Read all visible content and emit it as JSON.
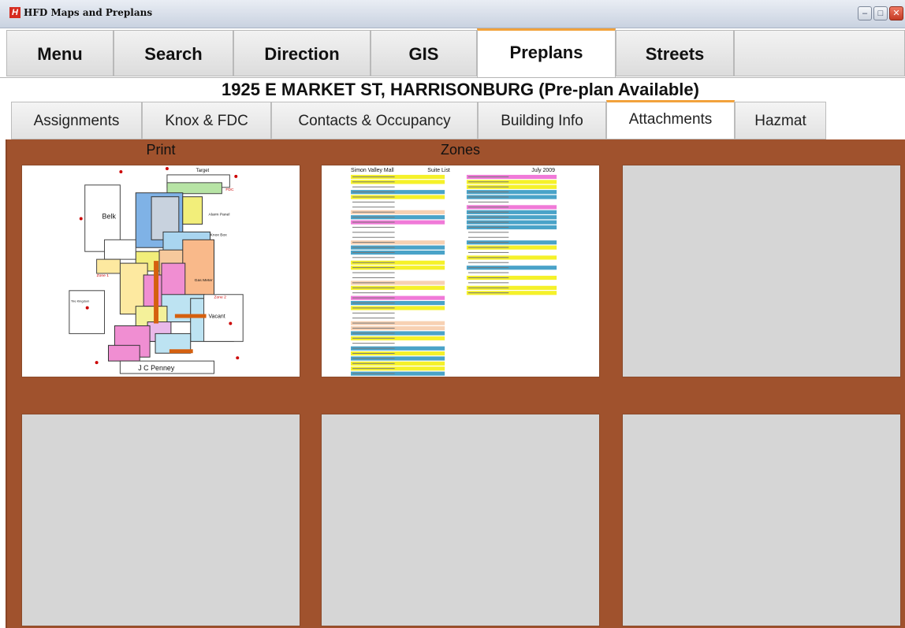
{
  "window": {
    "title": "HFD Maps and Preplans",
    "app_icon": "H",
    "minimize_glyph": "–",
    "maximize_glyph": "□",
    "close_glyph": "✕"
  },
  "main_tabs": [
    {
      "label": "Menu"
    },
    {
      "label": "Search"
    },
    {
      "label": "Direction"
    },
    {
      "label": "GIS"
    },
    {
      "label": "Preplans"
    },
    {
      "label": "Streets"
    }
  ],
  "address": "1925 E MARKET ST, HARRISONBURG (Pre-plan Available)",
  "sub_tabs": [
    {
      "label": "Assignments"
    },
    {
      "label": "Knox & FDC"
    },
    {
      "label": "Contacts & Occupancy"
    },
    {
      "label": "Building Info"
    },
    {
      "label": "Attachments"
    },
    {
      "label": "Hazmat"
    }
  ],
  "attachments": [
    {
      "label": "Print"
    },
    {
      "label": "Zones"
    }
  ],
  "plan_preview": {
    "stores": [
      "Belk",
      "Target",
      "J C Penney",
      "Vacant",
      "Tire Kingdom"
    ],
    "annotations": [
      "FDC",
      "Alarm Panel",
      "Gas Meter",
      "Knox Box",
      "Zone 1",
      "Zone 2"
    ]
  },
  "zones_preview": {
    "mall_name": "Simon Valley Mall",
    "list_title": "Suite List",
    "date": "July 2009"
  },
  "colors": {
    "panel_background": "#a0522d",
    "active_tab_accent": "#f2a23c"
  }
}
